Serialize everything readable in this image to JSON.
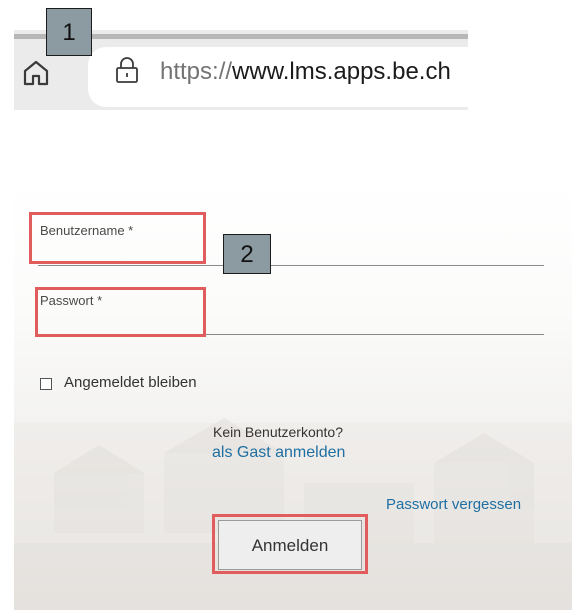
{
  "annotations": {
    "callout_1": "1",
    "callout_2": "2"
  },
  "browser": {
    "url_scheme": "https://",
    "url_host": "www.lms.apps.be.ch",
    "icons": [
      "home-icon",
      "lock-icon"
    ]
  },
  "login": {
    "username_label": "Benutzername *",
    "password_label": "Passwort *",
    "remember_label": "Angemeldet bleiben",
    "remember_checked": false,
    "no_account_text": "Kein Benutzerkonto?",
    "guest_link": "als Gast anmelden",
    "forgot_password_link": "Passwort vergessen",
    "submit_button": "Anmelden"
  },
  "colors": {
    "link": "#1f6fa2",
    "highlight_border": "#e15c5c",
    "callout_fill": "#8c9aa1"
  }
}
